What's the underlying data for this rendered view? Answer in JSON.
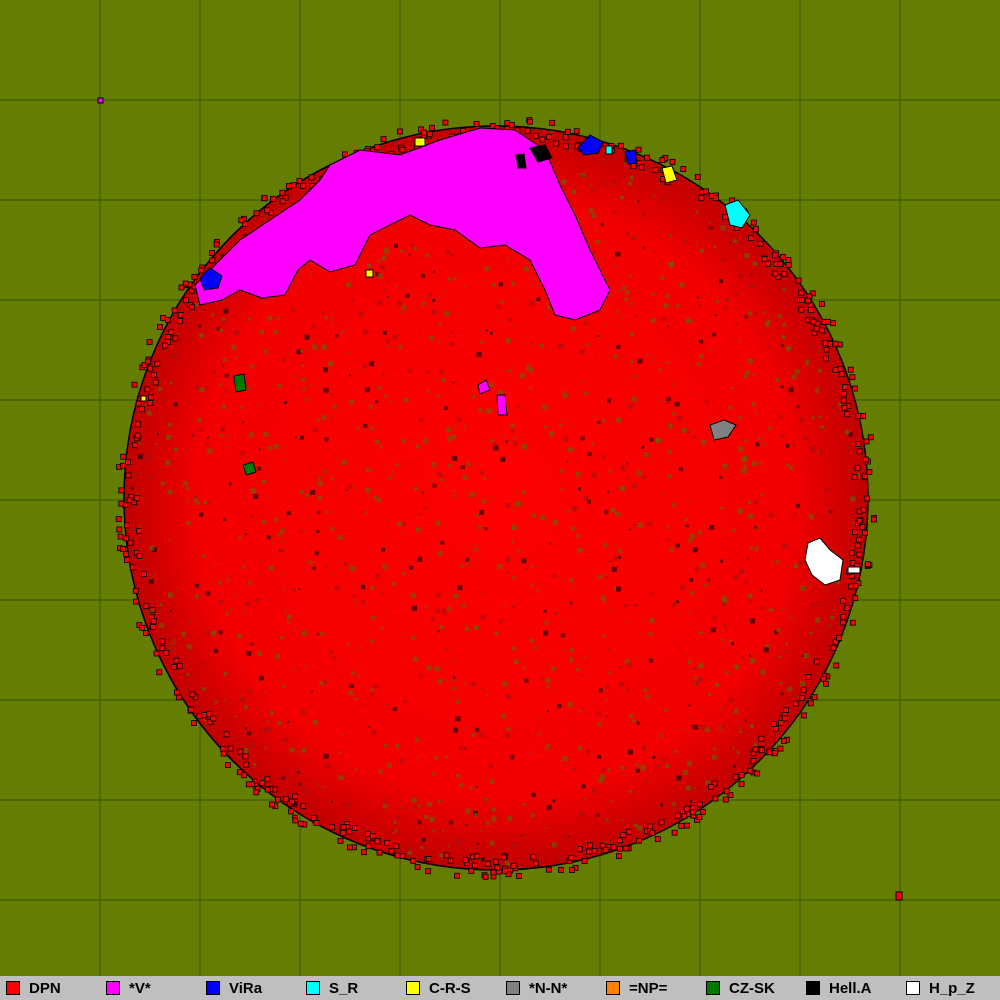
{
  "map": {
    "background_color": "#647d03",
    "grid_color": "#3d5200",
    "grid_lines": true
  },
  "legend": [
    {
      "label": "DPN",
      "color": "#ff0000"
    },
    {
      "label": "*V*",
      "color": "#ff00ff"
    },
    {
      "label": "ViRa",
      "color": "#0000ff"
    },
    {
      "label": "S_R",
      "color": "#00ffff"
    },
    {
      "label": "C-R-S",
      "color": "#ffff00"
    },
    {
      "label": "*N-N*",
      "color": "#808080"
    },
    {
      "label": "=NP=",
      "color": "#ff8000"
    },
    {
      "label": "CZ-SK",
      "color": "#007a00"
    },
    {
      "label": "Hell.A",
      "color": "#000000"
    },
    {
      "label": "H_p_Z",
      "color": "#ffffff"
    }
  ]
}
